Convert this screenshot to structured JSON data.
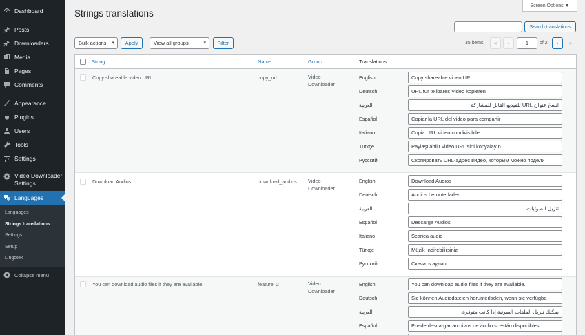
{
  "sidebar": {
    "dashboard": "Dashboard",
    "posts": "Posts",
    "downloaders": "Downloaders",
    "media": "Media",
    "pages": "Pages",
    "comments": "Comments",
    "appearance": "Appearance",
    "plugins": "Plugins",
    "users": "Users",
    "tools": "Tools",
    "settings": "Settings",
    "video_downloader_line1": "Video Downloader",
    "video_downloader_line2": "Settings",
    "languages": "Languages",
    "submenu": [
      "Languages",
      "Strings translations",
      "Settings",
      "Setup",
      "Lingotek"
    ],
    "collapse": "Collapse menu"
  },
  "header": {
    "title": "Strings translations",
    "screen_options": "Screen Options ▼"
  },
  "toolbar": {
    "bulk_actions": "Bulk actions",
    "apply": "Apply",
    "group_filter": "View all groups",
    "filter": "Filter",
    "search_button": "Search translations",
    "search_value": ""
  },
  "pagination": {
    "items": "35 items",
    "first": "«",
    "prev": "‹",
    "current_page": "1",
    "of_text": "of 2",
    "next": "›",
    "last": "»"
  },
  "table": {
    "columns": {
      "string": "String",
      "name": "Name",
      "group": "Group",
      "translations": "Translations"
    },
    "rows": [
      {
        "string": "Copy shareable video URL",
        "name": "copy_url",
        "group_line1": "Video",
        "group_line2": "Downloader",
        "translations": [
          {
            "lang": "English",
            "value": "Copy shareable video URL"
          },
          {
            "lang": "Deutsch",
            "value": "URL für teilbares Video kopieren"
          },
          {
            "lang": "العربية",
            "value": "انسخ عنوان URL للفيديو القابل للمشاركة"
          },
          {
            "lang": "Español",
            "value": "Copiar la URL del video para compartir"
          },
          {
            "lang": "Italiano",
            "value": "Copia URL video condivisibile"
          },
          {
            "lang": "Türkçe",
            "value": "Paylaşılabilir video URL'sini kopyalayın"
          },
          {
            "lang": "Русский",
            "value": "Скопировать URL-адрес видео, которым можно подели"
          }
        ]
      },
      {
        "string": "Download Audios",
        "name": "download_audios",
        "group_line1": "Video",
        "group_line2": "Downloader",
        "translations": [
          {
            "lang": "English",
            "value": "Download Audios"
          },
          {
            "lang": "Deutsch",
            "value": "Audios herunterladen"
          },
          {
            "lang": "العربية",
            "value": "تنزيل الصوتيات"
          },
          {
            "lang": "Español",
            "value": "Descarga Audios"
          },
          {
            "lang": "Italiano",
            "value": "Scarica audio"
          },
          {
            "lang": "Türkçe",
            "value": "Müzik İndirebilirsiniz"
          },
          {
            "lang": "Русский",
            "value": "Скачать аудио"
          }
        ]
      },
      {
        "string": "You can download audio files if they are available.",
        "name": "feature_2",
        "group_line1": "Video",
        "group_line2": "Downloader",
        "translations": [
          {
            "lang": "English",
            "value": "You can download audio files if they are available."
          },
          {
            "lang": "Deutsch",
            "value": "Sie können Audiodateien herunterladen, wenn sie verfügba"
          },
          {
            "lang": "العربية",
            "value": "يمكنك تنزيل الملفات الصوتية إذا كانت متوفرة."
          },
          {
            "lang": "Español",
            "value": "Puede descargar archivos de audio si están disponibles."
          }
        ]
      }
    ]
  }
}
